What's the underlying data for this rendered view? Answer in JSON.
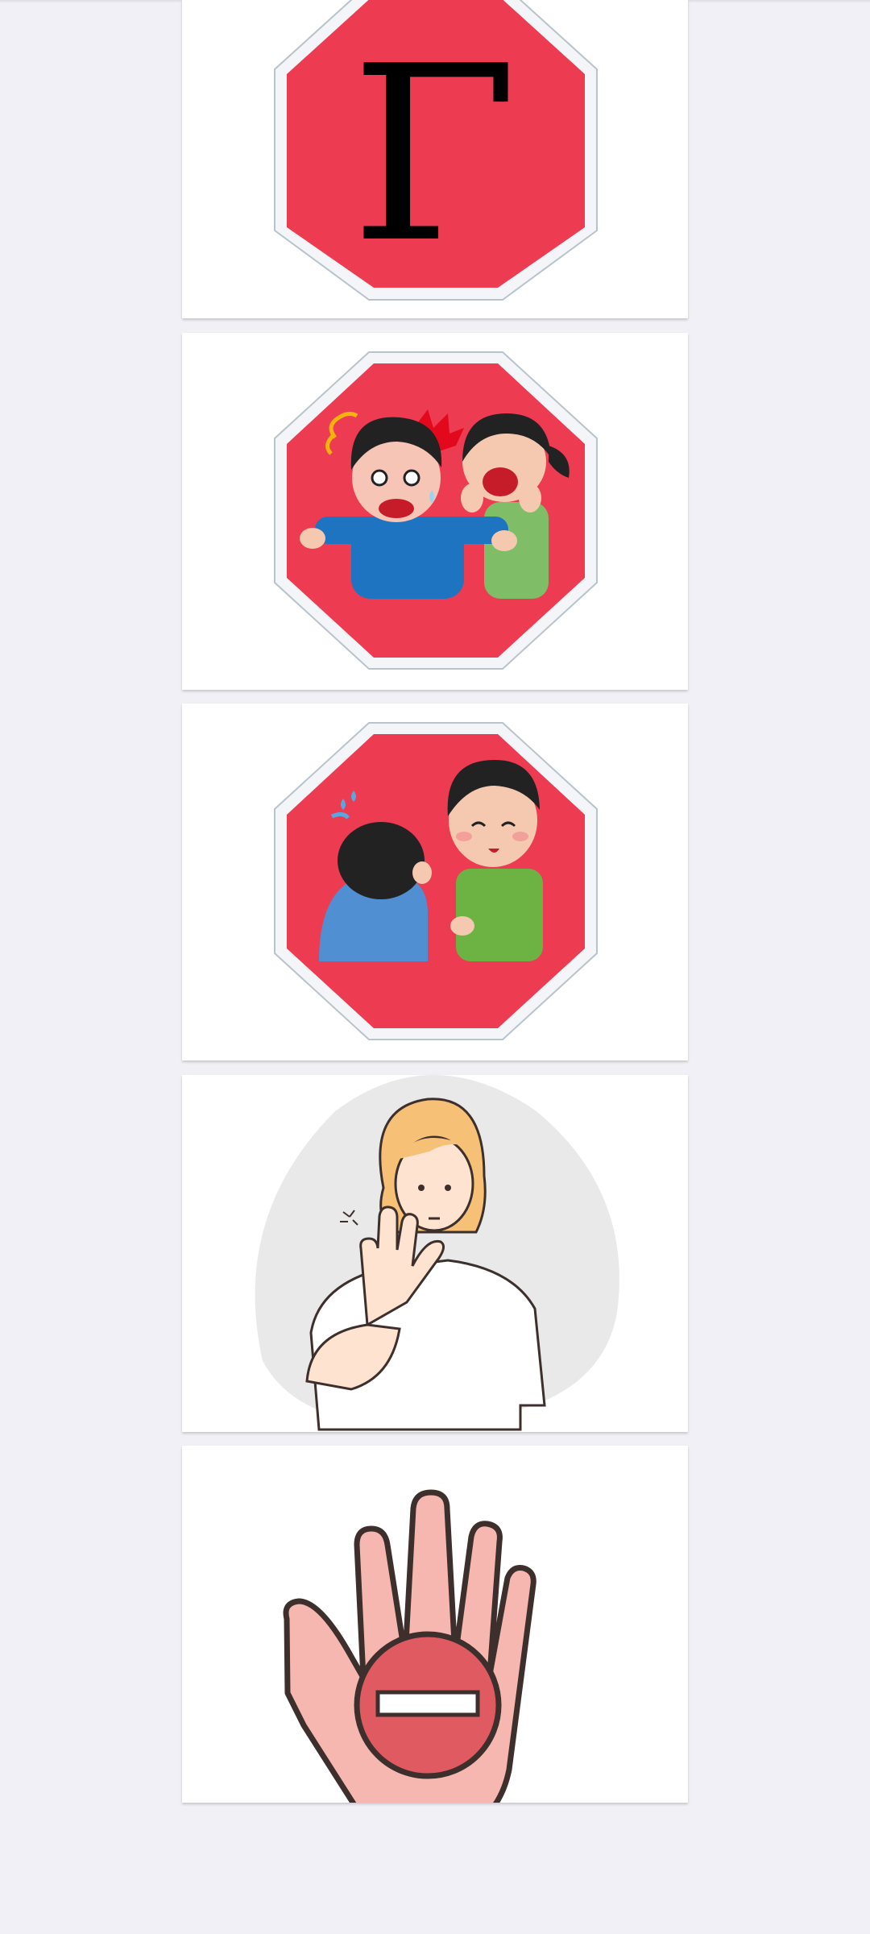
{
  "cards": [
    {
      "name": "stop-sign-gamma",
      "letter": "Γ",
      "colors": {
        "sign": "#ed3b52",
        "text": "#000000"
      }
    },
    {
      "name": "stop-sign-kids-surprised"
    },
    {
      "name": "stop-sign-kids-whisper"
    },
    {
      "name": "woman-stop-gesture"
    },
    {
      "name": "hand-no-entry",
      "colors": {
        "hand": "#f6b7b0",
        "circle": "#e05a62",
        "outline": "#3d2f2c"
      }
    }
  ]
}
